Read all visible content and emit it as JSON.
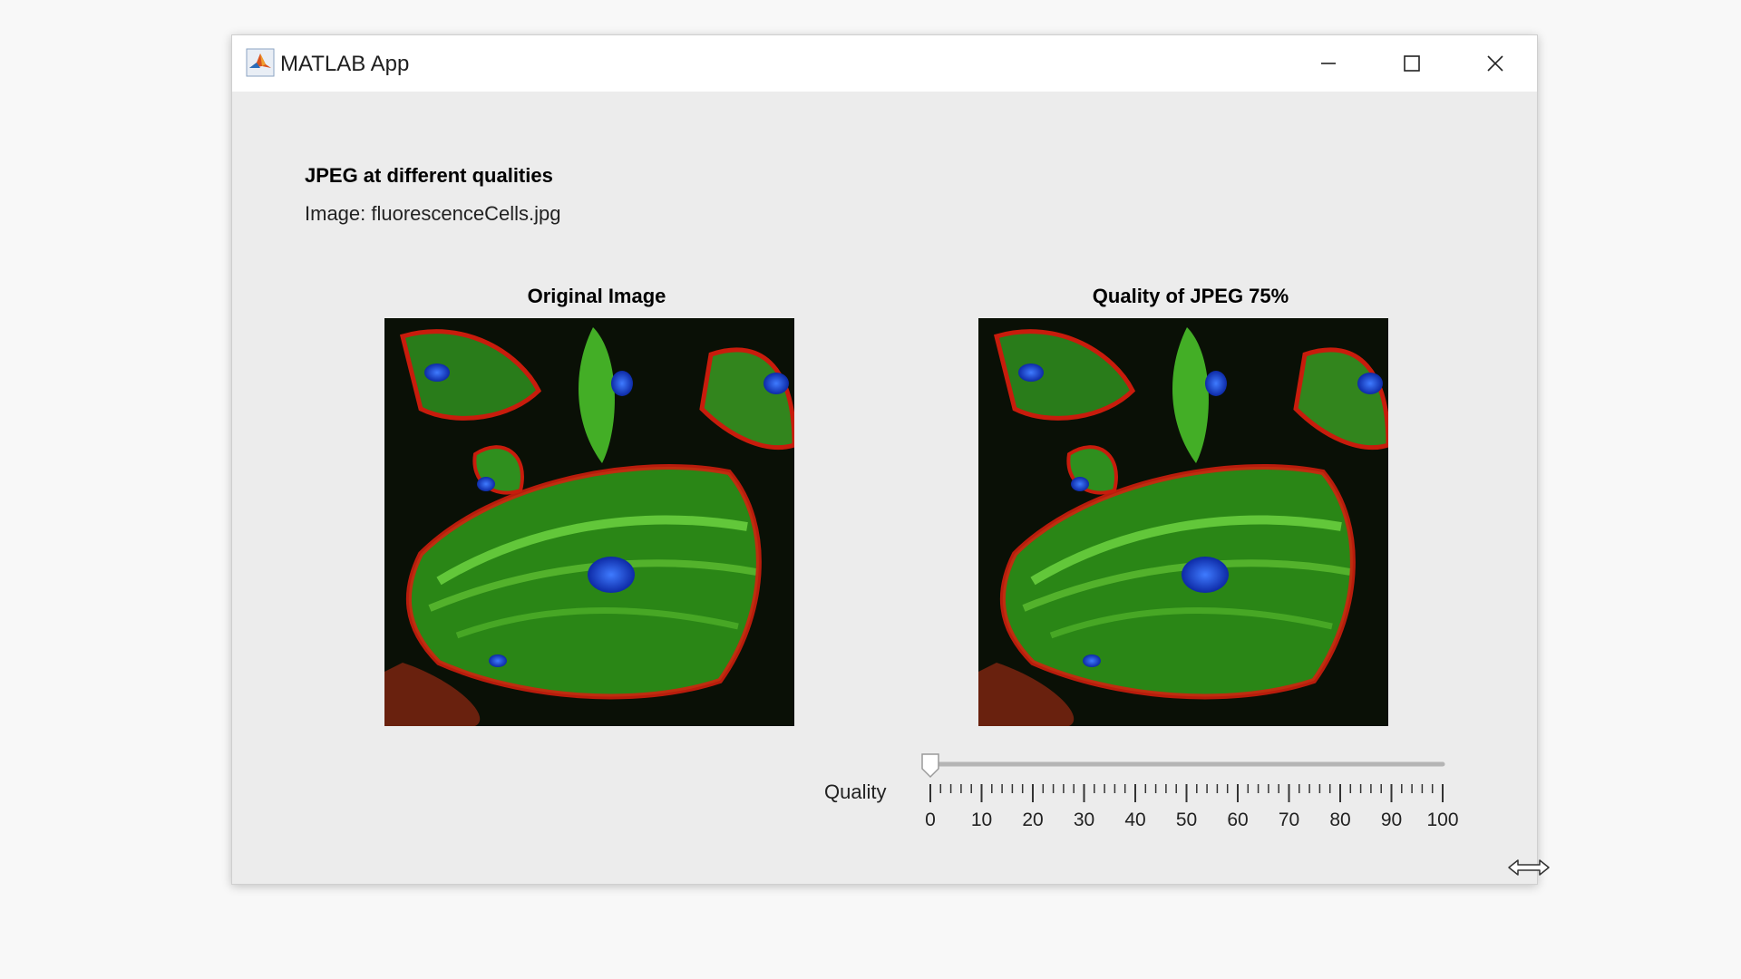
{
  "window": {
    "title": "MATLAB App",
    "icon": "matlab-logo-icon",
    "controls": [
      "minimize-icon",
      "maximize-icon",
      "close-icon"
    ]
  },
  "content": {
    "heading": "JPEG at different qualities",
    "subheading": "Image: fluorescenceCells.jpg"
  },
  "panels": {
    "original_title": "Original Image",
    "jpeg_title": "Quality of JPEG 75%"
  },
  "slider": {
    "label": "Quality",
    "min": 0,
    "max": 100,
    "value": 0,
    "tick_labels": [
      "0",
      "10",
      "20",
      "30",
      "40",
      "50",
      "60",
      "70",
      "80",
      "90",
      "100"
    ]
  },
  "colors": {
    "window_bg": "#ececec",
    "titlebar_bg": "#ffffff",
    "cell_green": "#3ccf2a",
    "cell_red": "#d81e0e",
    "nucleus_blue": "#1e4fe0"
  }
}
